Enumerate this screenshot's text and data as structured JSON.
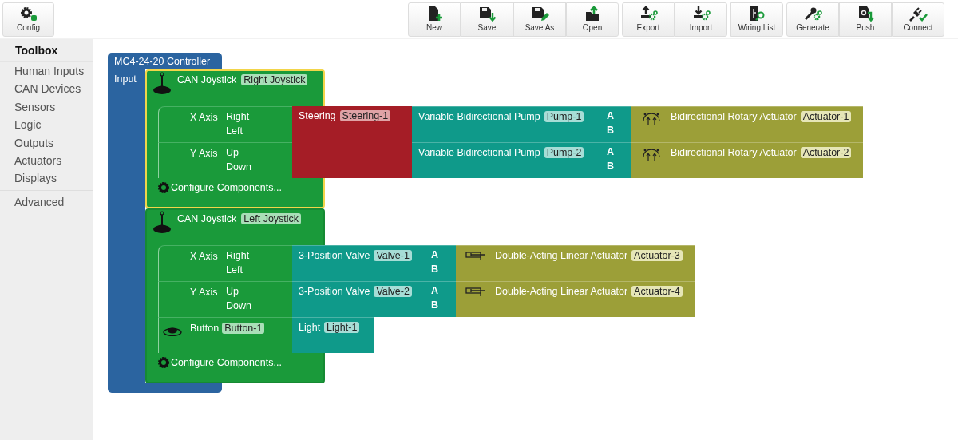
{
  "toolbar": {
    "config": {
      "label": "Config"
    },
    "groups": [
      [
        {
          "label": "New"
        },
        {
          "label": "Save"
        },
        {
          "label": "Save As"
        },
        {
          "label": "Open"
        }
      ],
      [
        {
          "label": "Export"
        },
        {
          "label": "Import"
        }
      ],
      [
        {
          "label": "Wiring List"
        }
      ],
      [
        {
          "label": "Generate"
        },
        {
          "label": "Push"
        },
        {
          "label": "Connect"
        }
      ]
    ]
  },
  "sidebar": {
    "title": "Toolbox",
    "categories": [
      "Human Inputs",
      "CAN Devices",
      "Sensors",
      "Logic",
      "Outputs",
      "Actuators",
      "Displays"
    ],
    "extra": [
      "Advanced"
    ]
  },
  "controller": {
    "title": "MC4-24-20 Controller",
    "input_label": "Input",
    "devices": [
      {
        "kind": "joystick",
        "title": "CAN Joystick",
        "tag": "Right Joystick",
        "selected": true,
        "inputs": [
          {
            "kind": "axis",
            "label": "X Axis",
            "ports": [
              "Right",
              "Left"
            ]
          },
          {
            "kind": "axis",
            "label": "Y Axis",
            "ports": [
              "Up",
              "Down"
            ]
          }
        ],
        "mapper": {
          "kind": "mapper",
          "title": "Steering",
          "tag": "Steering-1"
        },
        "chains": [
          [
            {
              "kind": "pump",
              "title": "Variable Bidirectional Pump",
              "tag": "Pump-1",
              "ports": [
                "A",
                "B"
              ]
            },
            {
              "kind": "rotary_actuator",
              "title": "Bidirectional Rotary Actuator",
              "tag": "Actuator-1"
            }
          ],
          [
            {
              "kind": "pump",
              "title": "Variable Bidirectional Pump",
              "tag": "Pump-2",
              "ports": [
                "A",
                "B"
              ]
            },
            {
              "kind": "rotary_actuator",
              "title": "Bidirectional Rotary Actuator",
              "tag": "Actuator-2"
            }
          ]
        ],
        "configure": "Configure Components..."
      },
      {
        "kind": "joystick",
        "title": "CAN Joystick",
        "tag": "Left Joystick",
        "selected": false,
        "inputs": [
          {
            "kind": "axis",
            "label": "X Axis",
            "ports": [
              "Right",
              "Left"
            ]
          },
          {
            "kind": "axis",
            "label": "Y Axis",
            "ports": [
              "Up",
              "Down"
            ]
          },
          {
            "kind": "button",
            "label": "Button",
            "tag": "Button-1"
          }
        ],
        "chains": [
          [
            {
              "kind": "valve",
              "title": "3-Position Valve",
              "tag": "Valve-1",
              "ports": [
                "A",
                "B"
              ]
            },
            {
              "kind": "linear_actuator",
              "title": "Double-Acting Linear Actuator",
              "tag": "Actuator-3"
            }
          ],
          [
            {
              "kind": "valve",
              "title": "3-Position Valve",
              "tag": "Valve-2",
              "ports": [
                "A",
                "B"
              ]
            },
            {
              "kind": "linear_actuator",
              "title": "Double-Acting Linear Actuator",
              "tag": "Actuator-4"
            }
          ],
          [
            {
              "kind": "light",
              "title": "Light",
              "tag": "Light-1"
            }
          ]
        ],
        "configure": "Configure Components..."
      }
    ]
  }
}
